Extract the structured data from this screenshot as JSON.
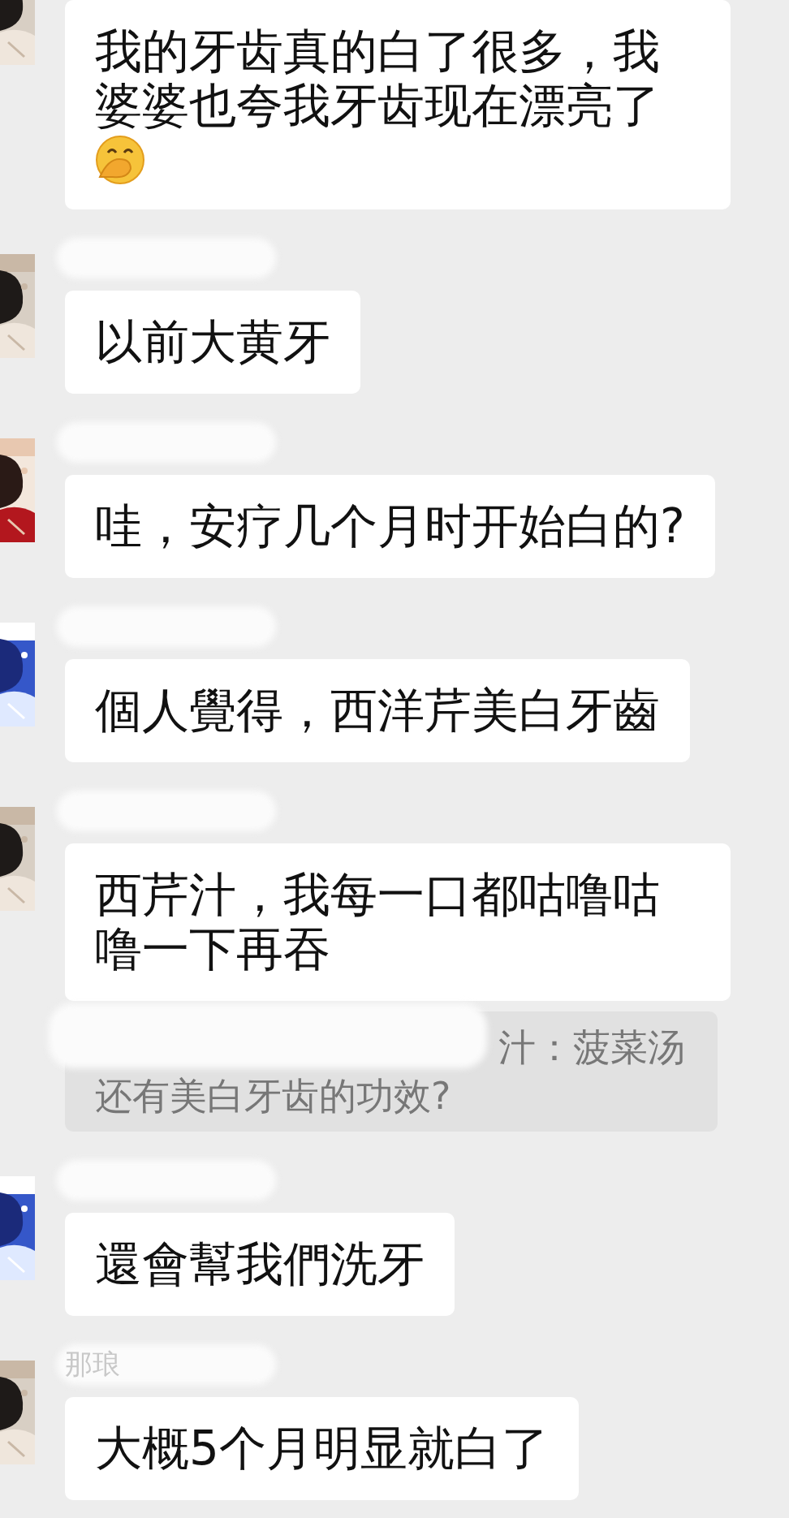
{
  "messages": [
    {
      "kind": "message",
      "lines": [
        "我的牙齿真的白了很多，我婆婆也夸我牙齿现在漂亮了"
      ],
      "emoji": true
    },
    {
      "kind": "message",
      "lines": [
        "以前大黄牙"
      ]
    },
    {
      "kind": "message",
      "lines": [
        "哇，安疗几个月时开始白的?"
      ]
    },
    {
      "kind": "message",
      "lines": [
        "個人覺得，西洋芹美白牙齒"
      ]
    },
    {
      "kind": "message",
      "lines": [
        "西芹汁，我每一口都咕噜咕噜一下再吞"
      ]
    },
    {
      "kind": "quote",
      "lines": [
        "汁：菠菜汤",
        "还有美白牙齿的功效?"
      ]
    },
    {
      "kind": "message",
      "lines": [
        "還會幫我們洗牙"
      ]
    },
    {
      "kind": "message",
      "sender": "那琅",
      "lines": [
        "大概5个月明显就白了"
      ]
    }
  ]
}
